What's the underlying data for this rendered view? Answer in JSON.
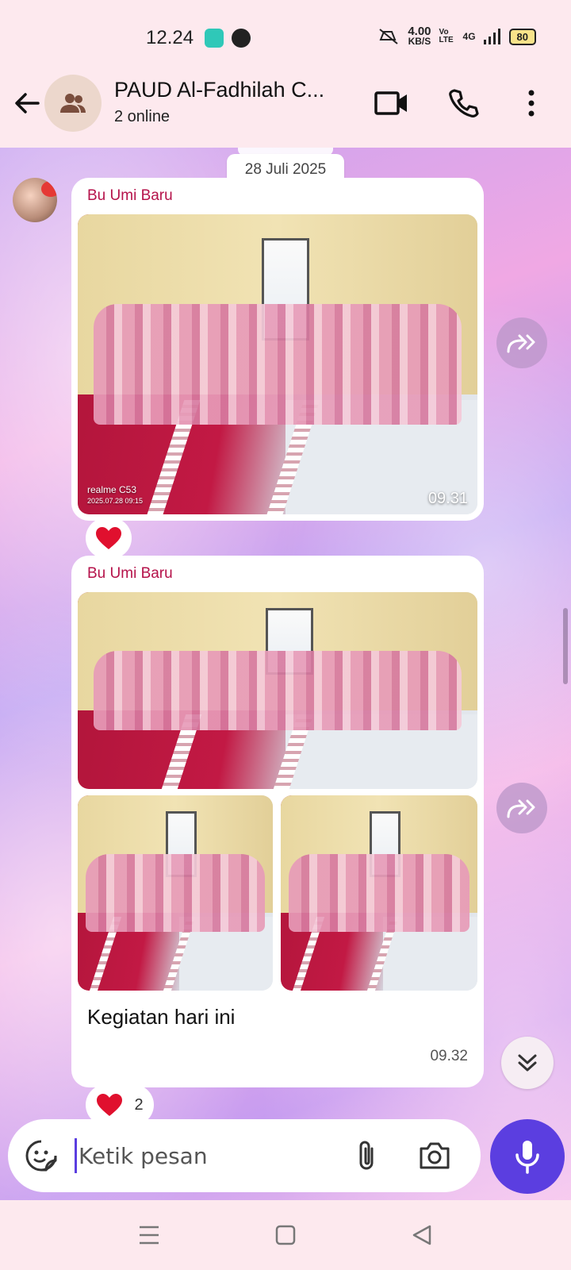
{
  "status_bar": {
    "time": "12.24",
    "speed_value": "4.00",
    "speed_unit": "KB/S",
    "volte": "Vo LTE",
    "network": "4G",
    "battery": "80"
  },
  "header": {
    "title": "PAUD Al-Fadhilah C...",
    "subtitle": "2 online"
  },
  "chat": {
    "date_chip": "28 Juli 2025",
    "messages": [
      {
        "sender": "Bu Umi Baru",
        "time": "09.31",
        "photo_watermark_device": "realme C53",
        "photo_watermark_date": "2025.07.28 09:15",
        "reaction_count": ""
      },
      {
        "sender": "Bu Umi Baru",
        "caption": "Kegiatan hari ini",
        "time": "09.32",
        "reaction_count": "2"
      }
    ]
  },
  "composer": {
    "placeholder": "Ketik pesan"
  },
  "colors": {
    "accent": "#5b3ee0",
    "sender_name": "#b5124a",
    "header_bg": "#fde9ee"
  }
}
